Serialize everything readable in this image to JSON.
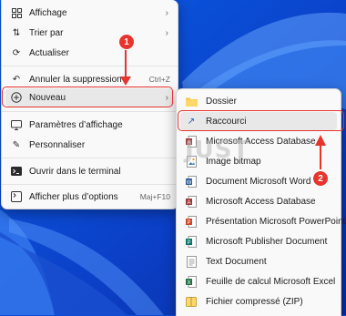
{
  "watermark": "JUST",
  "context_menu": {
    "items": [
      {
        "label": "Affichage",
        "icon": "grid-icon",
        "chevron": "›"
      },
      {
        "label": "Trier par",
        "icon": "sort-icon",
        "chevron": "›"
      },
      {
        "label": "Actualiser",
        "icon": "refresh-icon"
      },
      {
        "label": "Annuler la suppression",
        "icon": "undo-icon",
        "shortcut": "Ctrl+Z"
      },
      {
        "label": "Nouveau",
        "icon": "plus-icon",
        "chevron": "›"
      },
      {
        "label": "Paramètres d’affichage",
        "icon": "display-icon"
      },
      {
        "label": "Personnaliser",
        "icon": "pen-icon"
      },
      {
        "label": "Ouvrir dans le terminal",
        "icon": "terminal-icon"
      },
      {
        "label": "Afficher plus d’options",
        "icon": "more-options-icon",
        "shortcut": "Maj+F10"
      }
    ]
  },
  "submenu": {
    "items": [
      {
        "label": "Dossier",
        "icon": "folder-icon"
      },
      {
        "label": "Raccourci",
        "icon": "shortcut-arrow-icon"
      },
      {
        "label": "Microsoft Access Database",
        "icon": "access-icon"
      },
      {
        "label": "Image bitmap",
        "icon": "bitmap-icon"
      },
      {
        "label": "Document Microsoft Word",
        "icon": "word-icon"
      },
      {
        "label": "Microsoft Access Database",
        "icon": "access-icon"
      },
      {
        "label": "Présentation Microsoft PowerPoint",
        "icon": "powerpoint-icon"
      },
      {
        "label": "Microsoft Publisher Document",
        "icon": "publisher-icon"
      },
      {
        "label": "Text Document",
        "icon": "text-document-icon"
      },
      {
        "label": "Feuille de calcul Microsoft Excel",
        "icon": "excel-icon"
      },
      {
        "label": "Fichier compressé (ZIP)",
        "icon": "zip-icon"
      }
    ]
  },
  "annotations": {
    "badge_1": "1",
    "badge_2": "2"
  },
  "colors": {
    "highlight": "#e8342d",
    "wallpaper": "#0a4bd8"
  }
}
